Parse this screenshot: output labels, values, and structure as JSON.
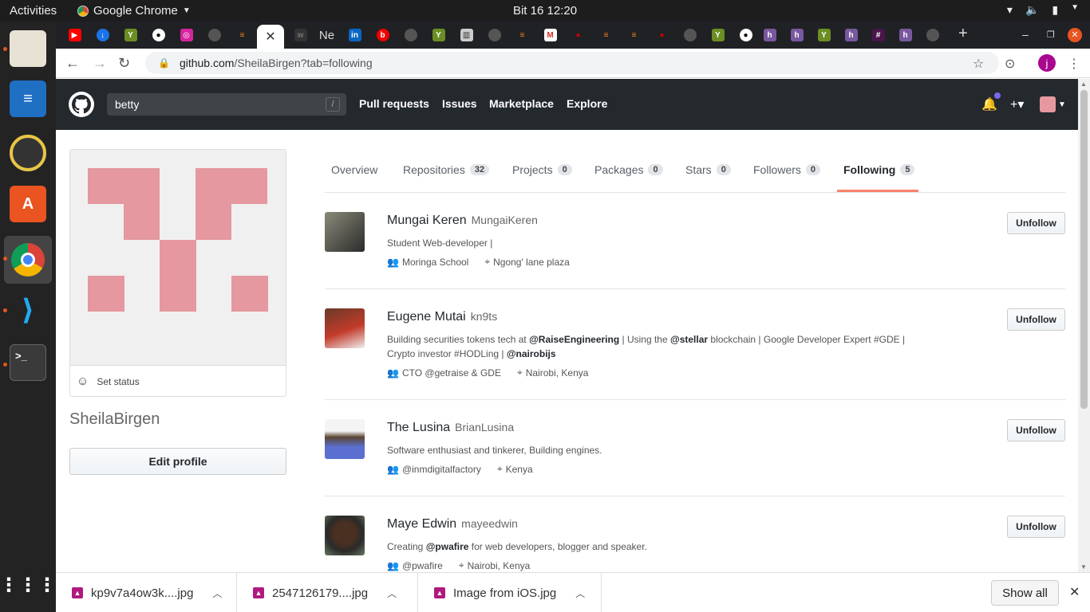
{
  "os": {
    "activities": "Activities",
    "app_name": "Google Chrome",
    "clock": "Bit 16  12:20"
  },
  "browser": {
    "tab_partial_title": "Ne",
    "url_host": "github.com",
    "url_path": "/SheilaBirgen?tab=following",
    "profile_initial": "j"
  },
  "github": {
    "search_value": "betty",
    "search_hint": "/",
    "nav": [
      "Pull requests",
      "Issues",
      "Marketplace",
      "Explore"
    ]
  },
  "profile": {
    "username": "SheilaBirgen",
    "set_status": "Set status",
    "edit_profile": "Edit profile",
    "identicon_color": "#e5989f"
  },
  "tabs": [
    {
      "label": "Overview",
      "count": ""
    },
    {
      "label": "Repositories",
      "count": "32"
    },
    {
      "label": "Projects",
      "count": "0"
    },
    {
      "label": "Packages",
      "count": "0"
    },
    {
      "label": "Stars",
      "count": "0"
    },
    {
      "label": "Followers",
      "count": "0"
    },
    {
      "label": "Following",
      "count": "5"
    }
  ],
  "following": [
    {
      "name": "Mungai Keren",
      "login": "MungaiKeren",
      "bio": "Student Web-developer |",
      "org": "Moringa School",
      "location": "Ngong' lane plaza",
      "button": "Unfollow"
    },
    {
      "name": "Eugene Mutai",
      "login": "kn9ts",
      "bio_1": "Building securities tokens tech at ",
      "bio_m1": "@RaiseEngineering",
      "bio_2": " | Using the ",
      "bio_m2": "@stellar",
      "bio_3": " blockchain | Google Developer Expert #GDE | Crypto investor #HODLing | ",
      "bio_m3": "@nairobijs",
      "org": "CTO @getraise & GDE",
      "location": "Nairobi, Kenya",
      "button": "Unfollow"
    },
    {
      "name": "The Lusina",
      "login": "BrianLusina",
      "bio": "Software enthusiast and tinkerer, Building engines.",
      "org": "@inmdigitalfactory",
      "location": "Kenya",
      "button": "Unfollow"
    },
    {
      "name": "Maye Edwin",
      "login": "mayeedwin",
      "bio_1": "Creating ",
      "bio_m1": "@pwafire",
      "bio_2": " for web developers, blogger and speaker.",
      "org": "@pwafire",
      "location": "Nairobi, Kenya",
      "button": "Unfollow"
    }
  ],
  "downloads": {
    "items": [
      "kp9v7a4ow3k....jpg",
      "2547126179....jpg",
      "Image from iOS.jpg"
    ],
    "show_all": "Show all"
  }
}
